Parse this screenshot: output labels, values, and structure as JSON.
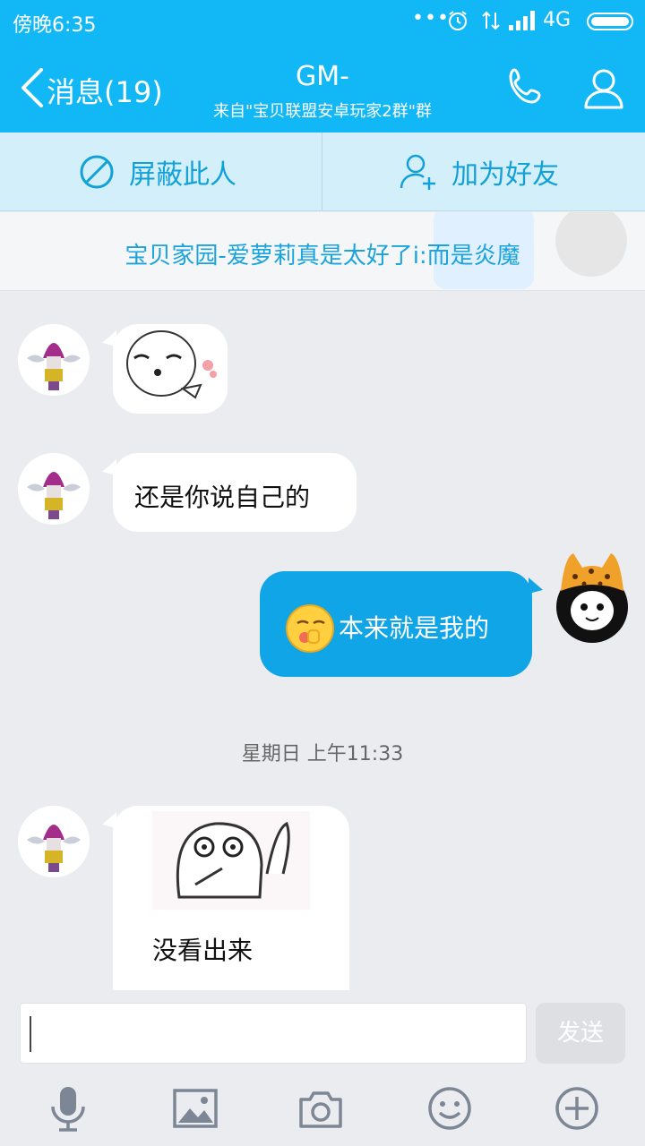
{
  "status_bar": {
    "time": "傍晚6:35",
    "dots": "•••",
    "network": "4G"
  },
  "header": {
    "back_label": "消息(19)",
    "title": "GM-",
    "subtitle": "来自\"宝贝联盟安卓玩家2群\"群"
  },
  "actions": {
    "block_label": "屏蔽此人",
    "add_friend_label": "加为好友"
  },
  "announcement": {
    "text": "宝贝家园-爱萝莉真是太好了i:而是炎魔"
  },
  "messages": [
    {
      "side": "left",
      "type": "sticker"
    },
    {
      "side": "left",
      "type": "text",
      "text": "还是你说自己的"
    },
    {
      "side": "right",
      "type": "text",
      "text": "本来就是我的"
    },
    {
      "side": "left",
      "type": "sticker_text",
      "text": "没看出来"
    }
  ],
  "timestamp": "星期日 上午11:33",
  "input": {
    "send_label": "发送"
  },
  "colors": {
    "accent": "#12b7f5",
    "bubble_right": "#0fa5e6",
    "background": "#ebecf0"
  }
}
